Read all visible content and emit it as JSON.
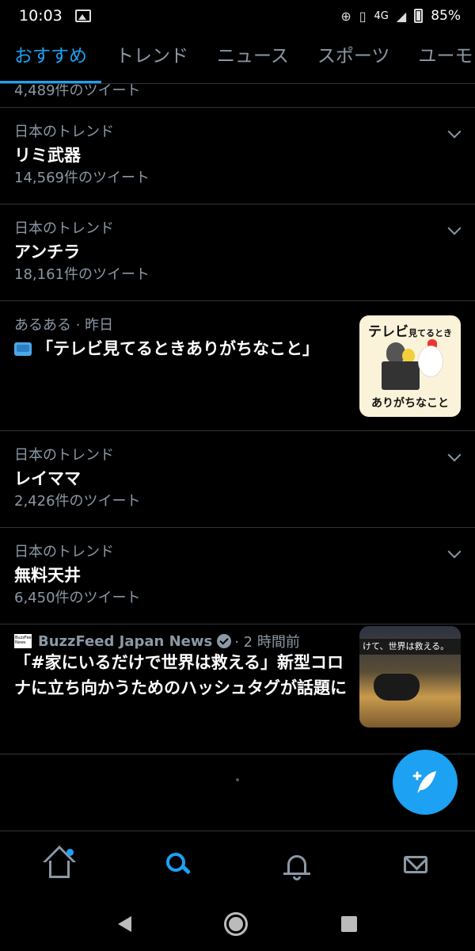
{
  "status_bar": {
    "time": "10:03",
    "network": "4G",
    "battery": "85%"
  },
  "tabs": [
    {
      "label": "おすすめ",
      "active": true
    },
    {
      "label": "トレンド",
      "active": false
    },
    {
      "label": "ニュース",
      "active": false
    },
    {
      "label": "スポーツ",
      "active": false
    },
    {
      "label": "ユーモ",
      "active": false
    }
  ],
  "feed": {
    "partial_count": "4,489件のツイート",
    "trends": [
      {
        "context": "日本のトレンド",
        "name": "リミ武器",
        "count": "14,569件のツイート"
      },
      {
        "context": "日本のトレンド",
        "name": "アンチラ",
        "count": "18,161件のツイート"
      }
    ],
    "moment": {
      "context": "あるある · 昨日",
      "headline": "「テレビ見てるときありがちなこと」",
      "thumb_top_big": "テレビ",
      "thumb_top_small": "見てるとき",
      "thumb_bottom": "ありがちなこと"
    },
    "trends2": [
      {
        "context": "日本のトレンド",
        "name": "レイママ",
        "count": "2,426件のツイート"
      },
      {
        "context": "日本のトレンド",
        "name": "無料天井",
        "count": "6,450件のツイート"
      }
    ],
    "news": {
      "source": "BuzzFeed Japan News",
      "time": "· 2 時間前",
      "headline": "「#家にいるだけで世界は救える」新型コロナに立ち向かうためのハッシュタグが話題に",
      "thumb_banner": "けて、世界は救える。",
      "logo_text": "BuzzFeed News"
    }
  },
  "colors": {
    "accent": "#1da1f2",
    "background": "#000000",
    "secondary_text": "#8b98a5",
    "divider": "#2f3336"
  },
  "icons": {
    "fab": "compose-tweet-icon",
    "nav": [
      "home-icon",
      "search-icon",
      "notifications-icon",
      "messages-icon"
    ]
  }
}
